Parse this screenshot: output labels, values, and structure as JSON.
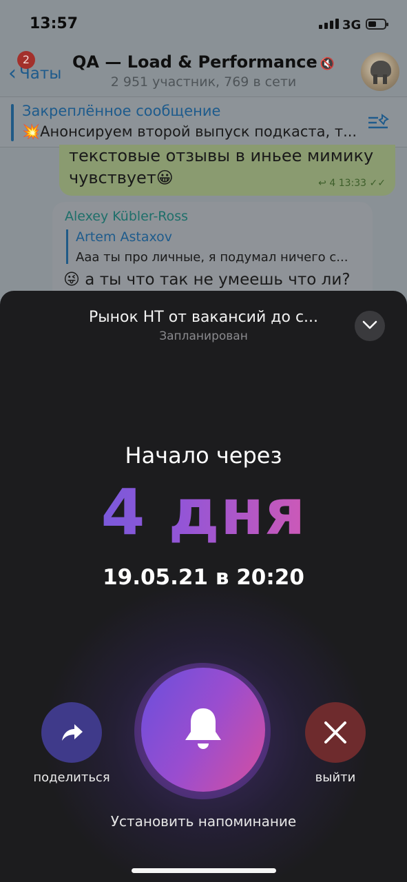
{
  "status_bar": {
    "time": "13:57",
    "network": "3G"
  },
  "nav": {
    "back_label": "Чаты",
    "unread_badge": "2",
    "title": "QA — Load & Performance",
    "subtitle": "2 951 участник, 769 в сети"
  },
  "pinned": {
    "title": "Закреплённое сообщение",
    "text": "💥Анонсируем второй выпуск подкаста, т..."
  },
  "messages": {
    "outgoing": {
      "line1": "текстовые отзывы в иньее мимику",
      "line2": "чувствует😀",
      "replies": "4",
      "time": "13:33"
    },
    "incoming": {
      "author": "Alexey Kübler-Ross",
      "reply_name": "Artem Astaxov",
      "reply_text": "Ааа ты про личные, я подумал ничего с...",
      "text": "😜 а ты что так не умеешь что ли?"
    }
  },
  "voice_chat": {
    "title": "Рынок НТ от вакансий до с...",
    "status": "Запланирован",
    "starts_in_label": "Начало через",
    "countdown": "4 дня",
    "datetime": "19.05.21 в 20:20",
    "share_label": "поделиться",
    "leave_label": "выйти",
    "reminder_label": "Установить напоминание"
  },
  "colors": {
    "sheet_bg": "#1c1c1e",
    "gradient_start": "#5b5fe0",
    "gradient_end": "#e05a9e",
    "share_bg": "#3f3a8a",
    "leave_bg": "#6e2b2d"
  },
  "icons": [
    "back-chevron-icon",
    "mute-icon",
    "pin-list-icon",
    "reply-icon",
    "double-check-icon",
    "chevron-down-icon",
    "share-arrow-icon",
    "close-icon",
    "bell-icon"
  ]
}
